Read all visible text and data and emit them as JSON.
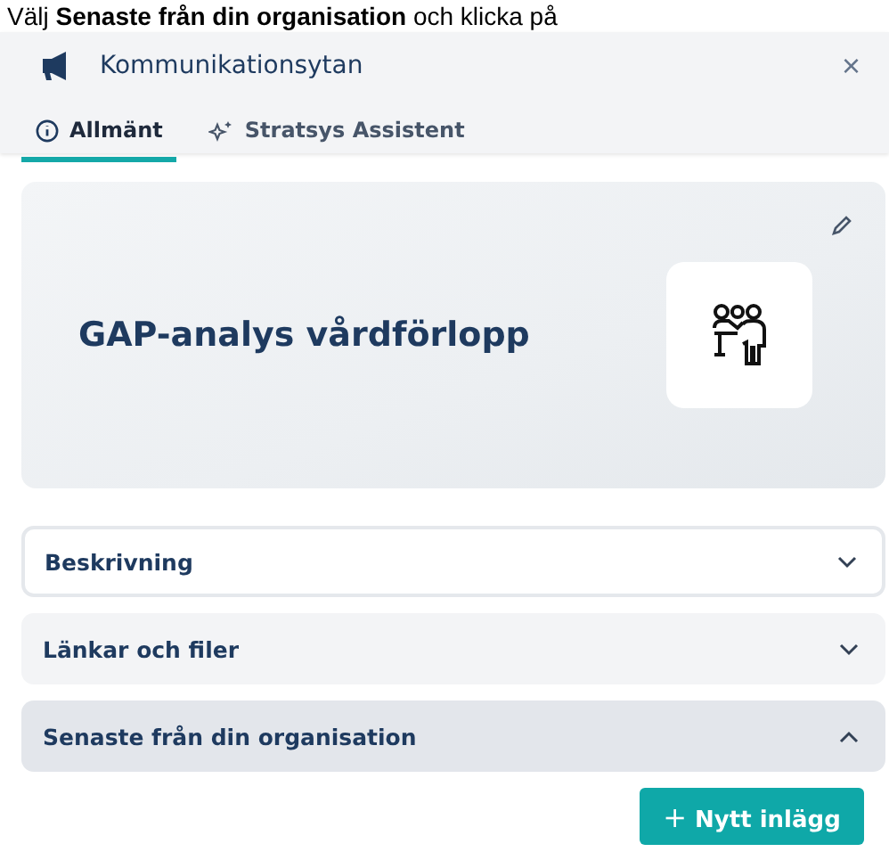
{
  "instruction": "Välj **Senaste från din organisation** och klicka på",
  "panel": {
    "title": "Kommunikationsytan",
    "close": "×"
  },
  "tabs": [
    {
      "label": "Allmänt",
      "selected": true
    },
    {
      "label": "Stratsys Assistent",
      "selected": false
    }
  ],
  "hero": {
    "title": "GAP-analys vårdförlopp"
  },
  "sections": [
    {
      "label": "Beskrivning",
      "expanded": false,
      "focused": true
    },
    {
      "label": "Länkar och filer",
      "expanded": false,
      "focused": false
    },
    {
      "label": "Senaste från din organisation",
      "expanded": true,
      "focused": false
    }
  ],
  "new_post_button": {
    "icon": "+",
    "label": "Nytt inlägg"
  }
}
